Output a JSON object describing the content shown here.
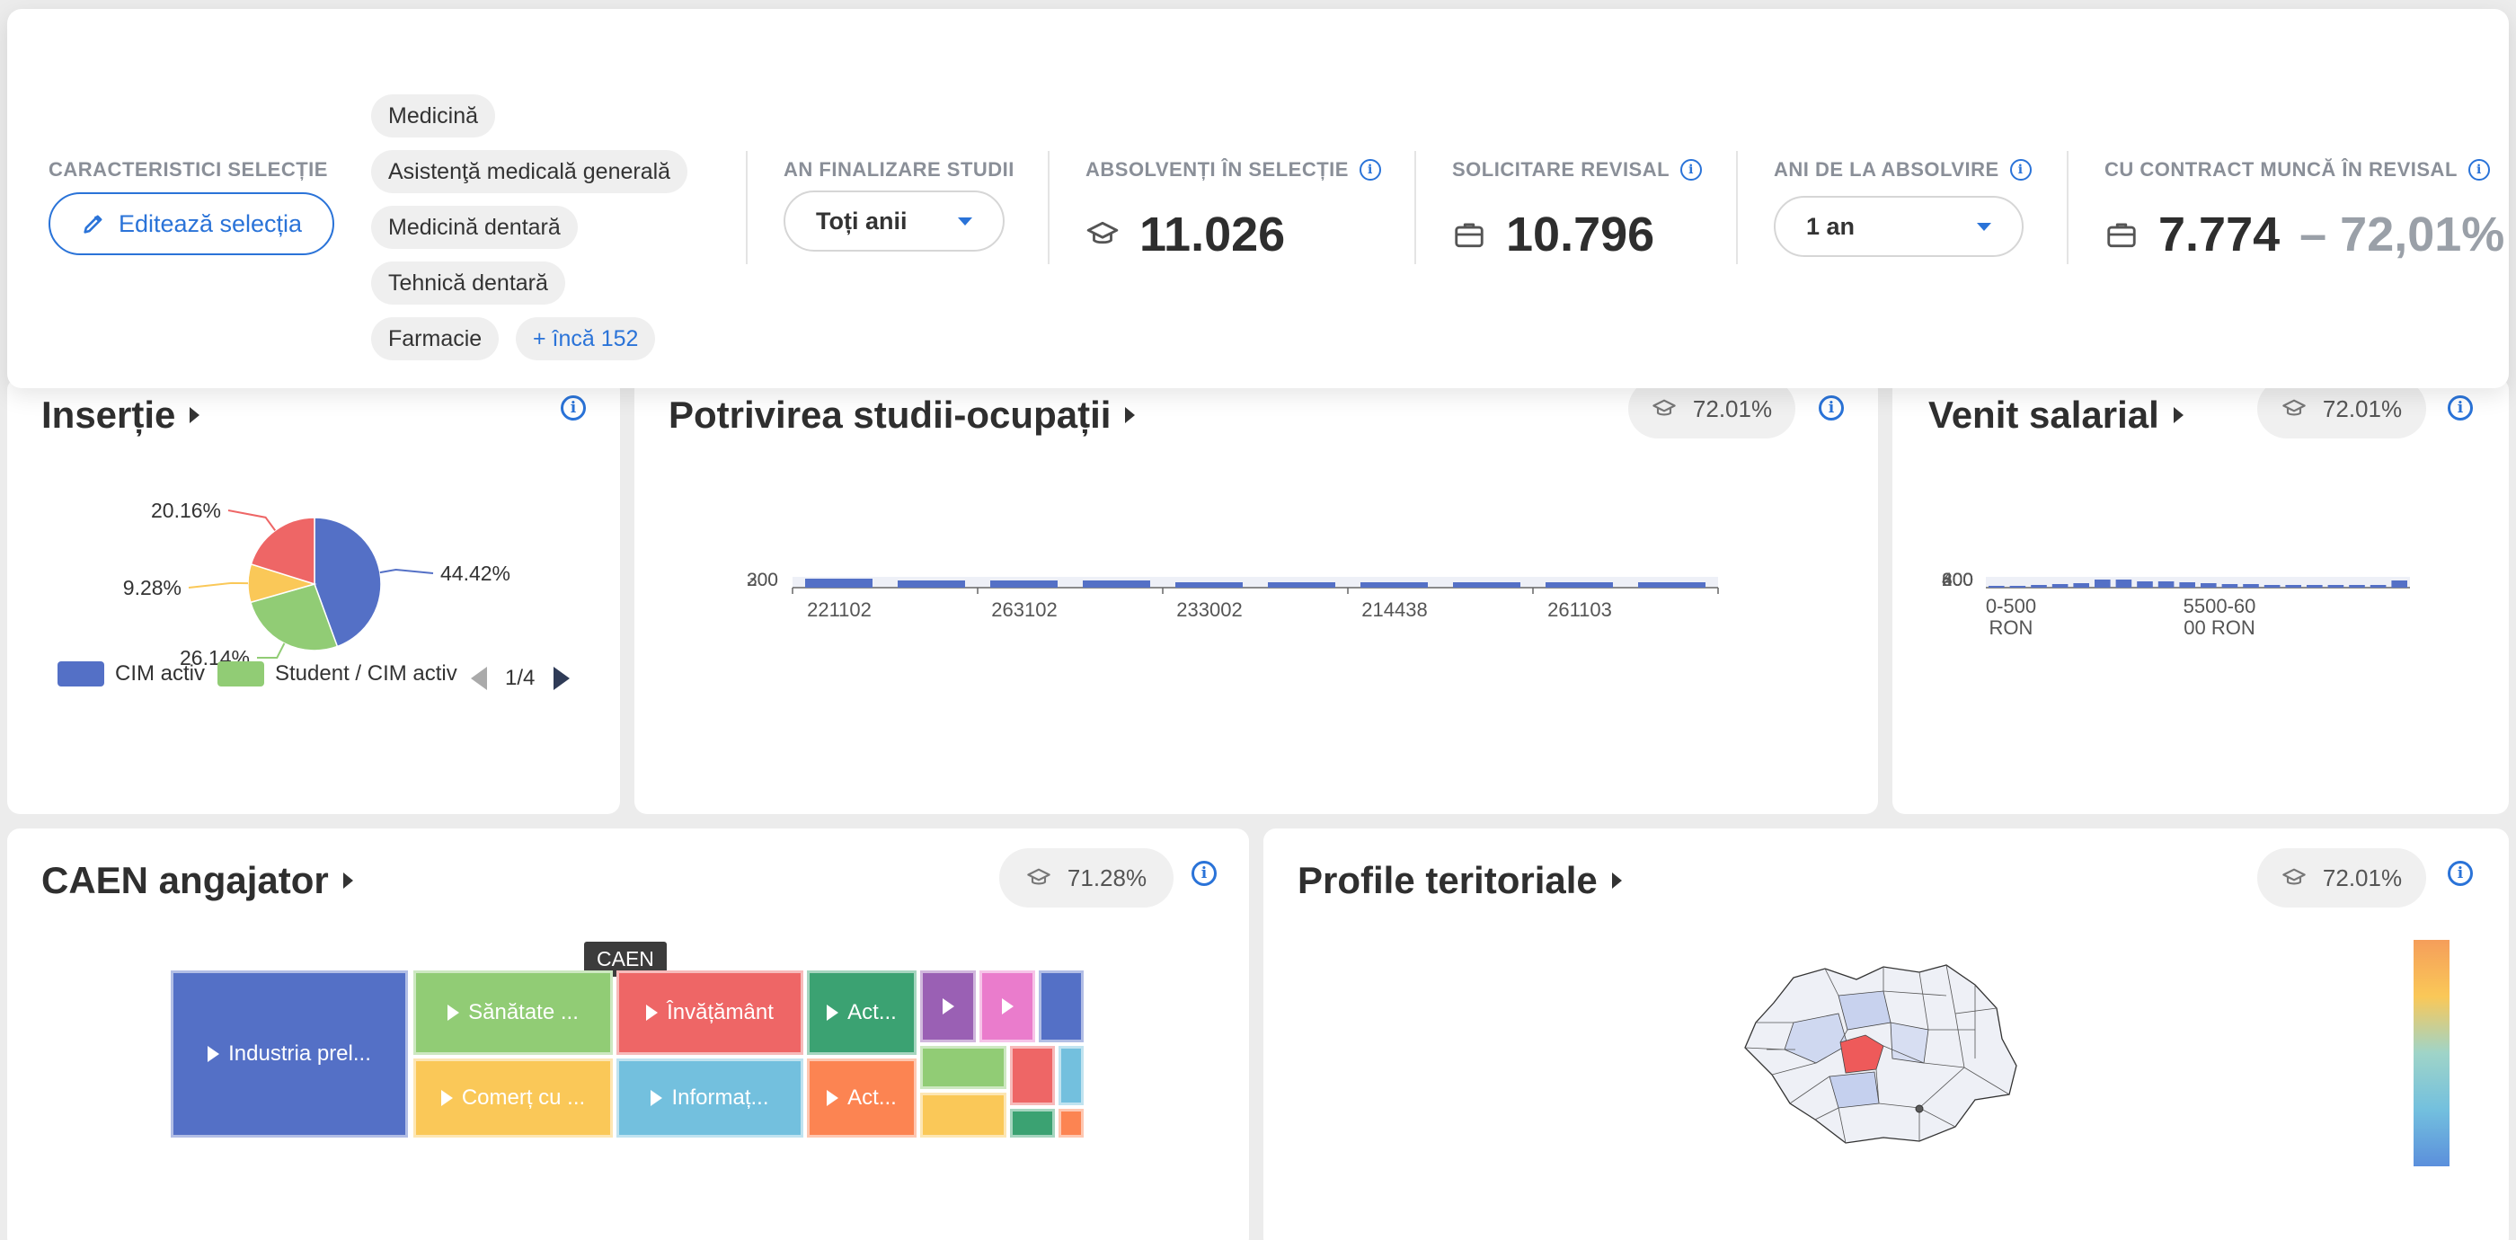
{
  "header": {
    "selection_label": "CARACTERISTICI SELECȚIE",
    "edit_button": "Editează selecția",
    "chips": [
      "Medicină",
      "Asistenţă medicală generală",
      "Medicină dentară",
      "Tehnică dentară",
      "Farmacie"
    ],
    "more_chip": "+ încă 152",
    "year_label": "AN FINALIZARE STUDII",
    "year_select": "Toți anii",
    "graduates_label": "ABSOLVENȚI ÎN SELECȚIE",
    "graduates_value": "11.026",
    "revisal_label": "SOLICITARE REVISAL",
    "revisal_value": "10.796",
    "years_since_label": "ANI DE LA ABSOLVIRE",
    "years_since_select": "1 an",
    "contract_label": "CU CONTRACT MUNCĂ ÎN REVISAL",
    "contract_value": "7.774",
    "contract_pct": "– 72,01%",
    "info_glyph": "i"
  },
  "insertie": {
    "title": "Inserție",
    "legend": [
      "CIM activ",
      "Student / CIM activ"
    ],
    "legend_colors": [
      "#5470c6",
      "#91cc75"
    ],
    "pager": "1/4",
    "chart_data": {
      "type": "pie",
      "values": [
        44.42,
        26.14,
        9.28,
        20.16
      ],
      "labels": [
        "44.42%",
        "26.14%",
        "9.28%",
        "20.16%"
      ],
      "colors": [
        "#5470c6",
        "#91cc75",
        "#fac858",
        "#ee6666"
      ]
    }
  },
  "potrivire": {
    "title": "Potrivirea studii-ocupații",
    "badge": "72.01%",
    "y_ticks": [
      "200",
      "300"
    ],
    "x_ticks": [
      "221102",
      "263102",
      "233002",
      "214438",
      "261103"
    ],
    "chart_data": {
      "type": "bar",
      "color": "#5470c6"
    }
  },
  "venit": {
    "title": "Venit salarial",
    "badge": "72.01%",
    "y_ticks": [
      "200",
      "400",
      "600",
      "800"
    ],
    "x_ticks": [
      [
        "0-500",
        "RON"
      ],
      [
        "5500-60",
        "00 RON"
      ]
    ],
    "chart_data": {
      "type": "bar",
      "color": "#5470c6"
    }
  },
  "caen": {
    "title": "CAEN angajator",
    "badge": "71.28%",
    "tooltip": "CAEN",
    "tiles": [
      {
        "label": "Industria prel...",
        "color": "#5470c6"
      },
      {
        "label": "Sănătate ...",
        "color": "#91cc75"
      },
      {
        "label": "Comerț cu ...",
        "color": "#fac858"
      },
      {
        "label": "Învățământ",
        "color": "#ee6666"
      },
      {
        "label": "Informaț...",
        "color": "#73c0de"
      },
      {
        "label": "Act...",
        "color": "#3ba272"
      },
      {
        "label": "Act...",
        "color": "#fc8452"
      },
      {
        "label": "",
        "color": "#9a60b4"
      },
      {
        "label": "",
        "color": "#ea7ccc"
      },
      {
        "label": "",
        "color": "#5470c6"
      },
      {
        "label": "",
        "color": "#91cc75"
      },
      {
        "label": "",
        "color": "#ee6666"
      },
      {
        "label": "",
        "color": "#73c0de"
      },
      {
        "label": "",
        "color": "#fac858"
      },
      {
        "label": "",
        "color": "#3ba272"
      },
      {
        "label": "",
        "color": "#fc8452"
      }
    ]
  },
  "profile": {
    "title": "Profile teritoriale",
    "badge": "72.01%"
  },
  "colors": {
    "accent": "#2a73d8",
    "series_blue": "#5470c6"
  }
}
